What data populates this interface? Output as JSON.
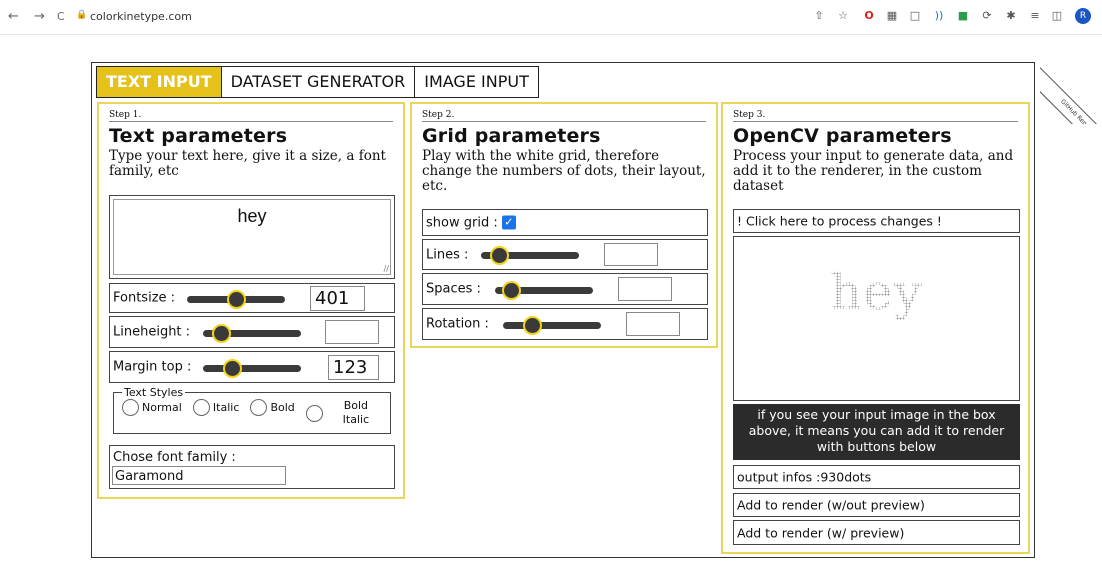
{
  "browser": {
    "back": "←",
    "forward": "→",
    "reload": "C",
    "url": "colorkinetype.com",
    "avatar_initial": "R",
    "ribbon_text": "GitHub Repo"
  },
  "tabs": [
    {
      "label": "TEXT INPUT",
      "active": true
    },
    {
      "label": "DATASET GENERATOR",
      "active": false
    },
    {
      "label": "IMAGE INPUT",
      "active": false
    }
  ],
  "step1": {
    "step": "Step 1.",
    "title": "Text parameters",
    "desc": "Type your text here, give it a size, a font family, etc",
    "text_value": "hey",
    "fontsize_label": "Fontsize :",
    "fontsize_value": "401",
    "fontsize_level": 0.5,
    "lineheight_label": "Lineheight :",
    "lineheight_value": "",
    "lineheight_level": 0.18,
    "margin_label": "Margin top :",
    "margin_value": "123",
    "margin_level": 0.3,
    "styles_legend": "Text Styles",
    "styles": [
      "Normal",
      "Italic",
      "Bold",
      "Bold Italic"
    ],
    "font_label": "Chose font family :",
    "font_value": "Garamond"
  },
  "step2": {
    "step": "Step 2.",
    "title": "Grid parameters",
    "desc": "Play with the white grid, therefore change the numbers of dots, their layout, etc.",
    "show_grid_label": "show grid :",
    "show_grid_checked": true,
    "lines_label": "Lines :",
    "lines_level": 0.18,
    "spaces_label": "Spaces :",
    "spaces_level": 0.16,
    "rotation_label": "Rotation :",
    "rotation_level": 0.3
  },
  "step3": {
    "step": "Step 3.",
    "title": "OpenCV parameters",
    "desc": "Process your input to generate data, and add it to the renderer, in the custom dataset",
    "process_button": "! Click here to process changes !",
    "preview_text": "hey",
    "info_box": "if you see your input image in the box above, it means you can add it to render with buttons below",
    "output_infos": "output infos :930dots",
    "add_no_preview": "Add to render (w/out preview)",
    "add_preview": "Add to render (w/ preview)"
  },
  "colors": {
    "accent": "#e5c21a",
    "panel_border": "#e9d65a",
    "knob_border": "#f2d21a",
    "dark_box": "#2b2b2b"
  }
}
